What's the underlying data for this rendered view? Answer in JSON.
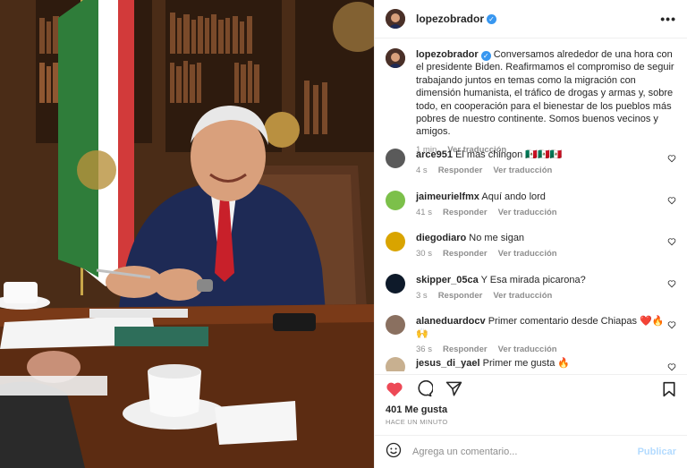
{
  "header": {
    "username": "lopezobrador",
    "more_icon": "more-horizontal-icon"
  },
  "caption": {
    "username": "lopezobrador",
    "text": "Conversamos alrededor de una hora con el presidente Biden. Reafirmamos el compromiso de seguir trabajando juntos en temas como la migración con dimensión humanista, el tráfico de drogas y armas y, sobre todo, en cooperación para el bienestar de los pueblos más pobres de nuestro continente. Somos buenos vecinos y amigos.",
    "time": "1 min",
    "translate": "Ver traducción"
  },
  "comments": [
    {
      "user": "arce951",
      "text": "El mas chingon 🇲🇽🇲🇽🇲🇽",
      "time": "4 s",
      "reply": "Responder",
      "translate": "Ver traducción",
      "avatar_color": "#5a5a5a"
    },
    {
      "user": "jaimeurielfmx",
      "text": "Aquí ando lord",
      "time": "41 s",
      "reply": "Responder",
      "translate": "Ver traducción",
      "avatar_color": "#7cc04a"
    },
    {
      "user": "diegodiaro",
      "text": "No me sigan",
      "time": "30 s",
      "reply": "Responder",
      "translate": "Ver traducción",
      "avatar_color": "#d9a400"
    },
    {
      "user": "skipper_05ca",
      "text": "Y Esa mirada picarona?",
      "time": "3 s",
      "reply": "Responder",
      "translate": "Ver traducción",
      "avatar_color": "#0e1a2a"
    },
    {
      "user": "alaneduardocv",
      "text": "Primer comentario desde Chiapas ❤️🔥🙌",
      "time": "36 s",
      "reply": "Responder",
      "translate": "Ver traducción",
      "avatar_color": "#8a7060"
    },
    {
      "user": "jesus_di_yael",
      "text": "Primer me gusta 🔥",
      "time": "",
      "reply": "",
      "translate": "",
      "avatar_color": "#c8b090"
    }
  ],
  "stats": {
    "likes": "401 Me gusta",
    "posted": "HACE UN MINUTO"
  },
  "add_comment": {
    "placeholder": "Agrega un comentario...",
    "post_label": "Publicar"
  },
  "colors": {
    "like_red": "#ed4956",
    "verified_blue": "#3897f0",
    "post_disabled": "#b3dbff"
  }
}
